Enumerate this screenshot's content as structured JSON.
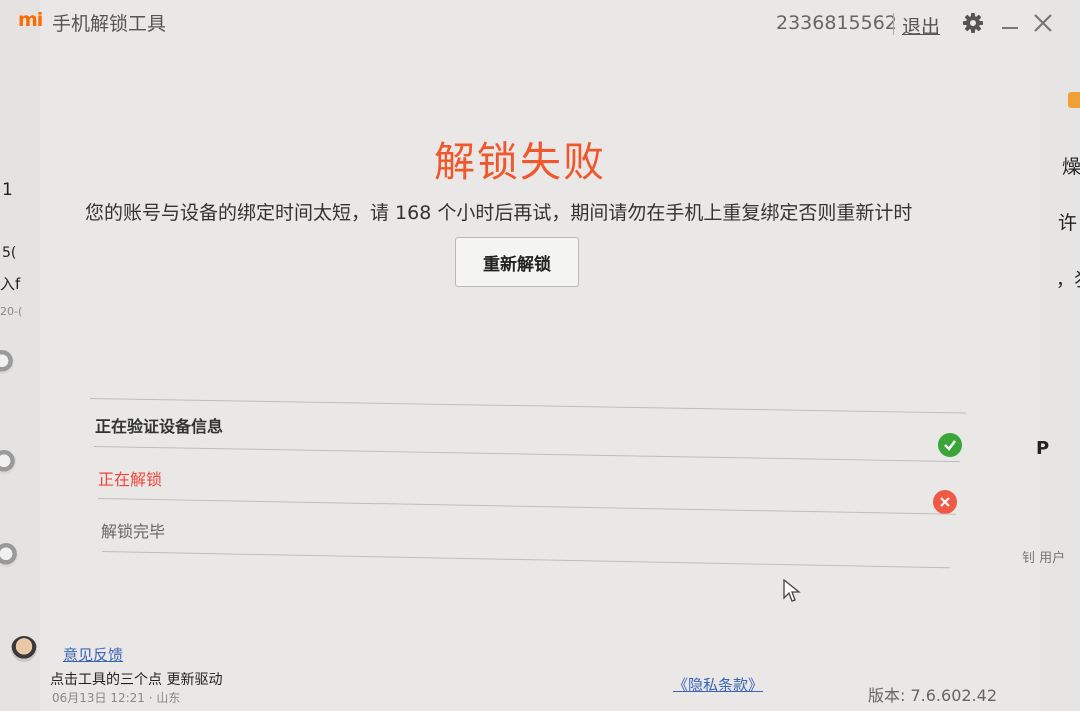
{
  "titlebar": {
    "logo": "mi",
    "app_title": "手机解锁工具",
    "account_id": "2336815562",
    "logout_label": "退出",
    "icons": [
      "gear-icon",
      "minimize-icon",
      "close-icon"
    ]
  },
  "main": {
    "heading": "解锁失败",
    "message": "您的账号与设备的绑定时间太短，请 168 个小时后再试，期间请勿在手机上重复绑定否则重新计时",
    "retry_button": "重新解锁"
  },
  "steps": [
    {
      "label": "正在验证设备信息",
      "status": "success",
      "icon": "check-icon"
    },
    {
      "label": "正在解锁",
      "status": "failed",
      "icon": "x-icon"
    },
    {
      "label": "解锁完毕",
      "status": "pending"
    }
  ],
  "footer": {
    "feedback_label": "意见反馈",
    "privacy_label": "《隐私条款》",
    "version_label": "版本: 7.6.602.42"
  },
  "background_app": {
    "left_fragments": [
      "1",
      "5(",
      "入f",
      "20-("
    ],
    "right_fragments": [
      "燥",
      "许",
      "，犭",
      "P",
      "钊 用户"
    ],
    "post_text": "点击工具的三个点 更新驱动",
    "post_meta": "06月13日 12:21 · 山东"
  },
  "colors": {
    "brand": "#ff6a00",
    "error": "#f0572d",
    "success": "#3aa63a",
    "link": "#3b63b6"
  }
}
